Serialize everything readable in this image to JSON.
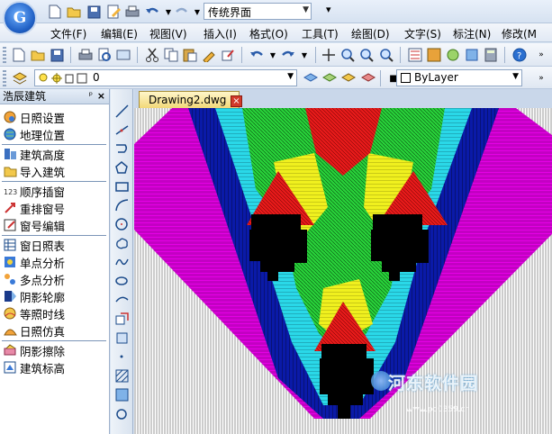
{
  "app": {
    "logo_letter": "G",
    "workspace": "传统界面"
  },
  "menu": [
    {
      "label": "文件(F)"
    },
    {
      "label": "编辑(E)"
    },
    {
      "label": "视图(V)"
    },
    {
      "label": "插入(I)"
    },
    {
      "label": "格式(O)"
    },
    {
      "label": "工具(T)"
    },
    {
      "label": "绘图(D)"
    },
    {
      "label": "文字(S)"
    },
    {
      "label": "标注(N)"
    },
    {
      "label": "修改(M"
    }
  ],
  "layer_toolbar": {
    "current_layer": "0",
    "color": "ByLayer"
  },
  "panel": {
    "title": "浩辰建筑",
    "pin_symbol": "ᵖ",
    "close_symbol": "×",
    "groups": [
      [
        {
          "label": "日照设置",
          "icon": "sun-settings-icon"
        },
        {
          "label": "地理位置",
          "icon": "globe-icon"
        }
      ],
      [
        {
          "label": "建筑高度",
          "icon": "building-height-icon"
        },
        {
          "label": "导入建筑",
          "icon": "import-folder-icon"
        }
      ],
      [
        {
          "label": "顺序插窗",
          "icon": "sequence-window-icon"
        },
        {
          "label": "重排窗号",
          "icon": "reorder-window-icon"
        },
        {
          "label": "窗号编辑",
          "icon": "edit-window-icon"
        }
      ],
      [
        {
          "label": "窗日照表",
          "icon": "window-table-icon"
        },
        {
          "label": "单点分析",
          "icon": "single-point-icon"
        },
        {
          "label": "多点分析",
          "icon": "multi-point-icon"
        },
        {
          "label": "阴影轮廓",
          "icon": "shadow-outline-icon"
        },
        {
          "label": "等照时线",
          "icon": "isoline-icon"
        },
        {
          "label": "日照仿真",
          "icon": "simulation-icon"
        }
      ],
      [
        {
          "label": "阴影擦除",
          "icon": "shadow-erase-icon"
        },
        {
          "label": "建筑标高",
          "icon": "elevation-icon"
        }
      ]
    ]
  },
  "document": {
    "tab_title": "Drawing2.dwg",
    "close_symbol": "×"
  },
  "watermark": {
    "text": "河东软件园",
    "sub": "www.pc0359.cn"
  },
  "colors": {
    "magenta": "#e600e6",
    "navy": "#0a1aa8",
    "cyan": "#2ad8e8",
    "green": "#28d23a",
    "yellow": "#f0f01e",
    "red": "#e51a1a",
    "black": "#000000"
  }
}
